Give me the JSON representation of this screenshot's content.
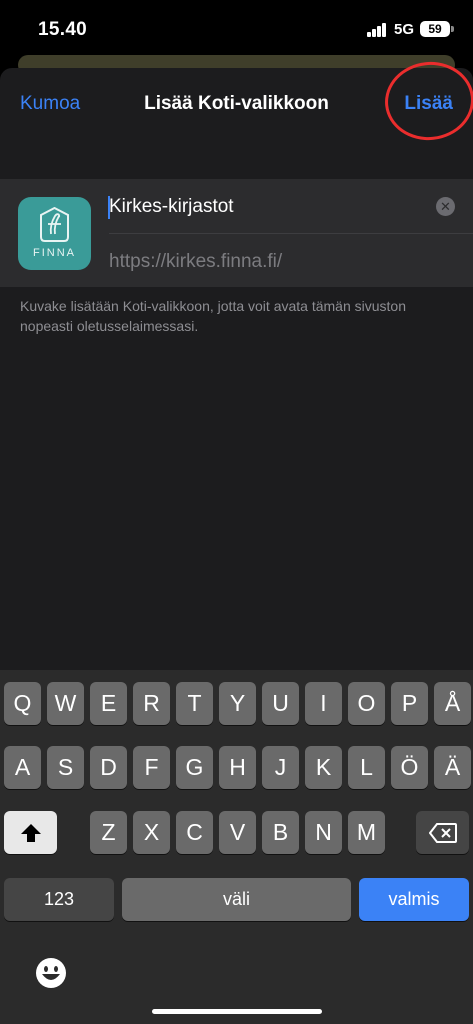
{
  "status_bar": {
    "time": "15.40",
    "network": "5G",
    "battery": "59"
  },
  "nav": {
    "cancel_label": "Kumoa",
    "title": "Lisää Koti-valikkoon",
    "add_label": "Lisää"
  },
  "form": {
    "app_icon_text": "FINNA",
    "title_value": "Kirkes-kirjastot",
    "url": "https://kirkes.finna.fi/"
  },
  "hint_text": "Kuvake lisätään Koti-valikkoon, jotta voit avata tämän sivuston nopeasti oletusselaimessasi.",
  "keyboard": {
    "row1": [
      "Q",
      "W",
      "E",
      "R",
      "T",
      "Y",
      "U",
      "I",
      "O",
      "P",
      "Å"
    ],
    "row2": [
      "A",
      "S",
      "D",
      "F",
      "G",
      "H",
      "J",
      "K",
      "L",
      "Ö",
      "Ä"
    ],
    "row3": [
      "Z",
      "X",
      "C",
      "V",
      "B",
      "N",
      "M"
    ],
    "numbers_label": "123",
    "space_label": "väli",
    "done_label": "valmis",
    "shift_icon": "shift-icon",
    "backspace_icon": "backspace-icon",
    "emoji_icon": "emoji-icon"
  },
  "colors": {
    "accent": "#3b82f6",
    "annotation": "#ea2d2d",
    "app_icon_bg": "#3a9b98"
  }
}
